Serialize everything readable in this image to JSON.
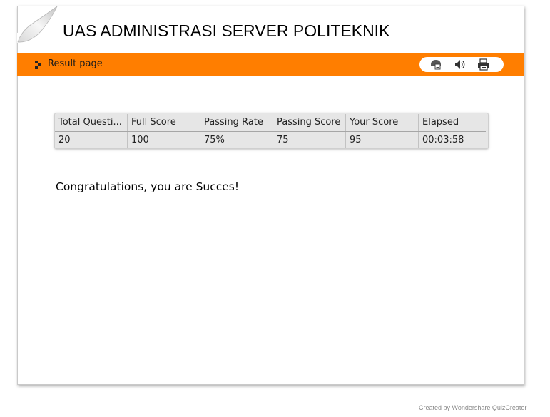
{
  "header": {
    "title": "UAS ADMINISTRASI SERVER POLITEKNIK"
  },
  "bar": {
    "label": "Result page",
    "tools": [
      {
        "icon": "review-icon"
      },
      {
        "icon": "sound-icon"
      },
      {
        "icon": "print-icon"
      }
    ]
  },
  "result_table": {
    "headers": [
      "Total Questi...",
      "Full Score",
      "Passing Rate",
      "Passing Score",
      "Your Score",
      "Elapsed"
    ],
    "values": [
      "20",
      "100",
      "75%",
      "75",
      "95",
      "00:03:58"
    ]
  },
  "message": "Congratulations, you are Succes!",
  "footer": {
    "prefix": "Created by",
    "link": "Wondershare QuizCreator"
  },
  "colors": {
    "accent": "#ff7e00",
    "table_bg": "#e6e6e6"
  }
}
